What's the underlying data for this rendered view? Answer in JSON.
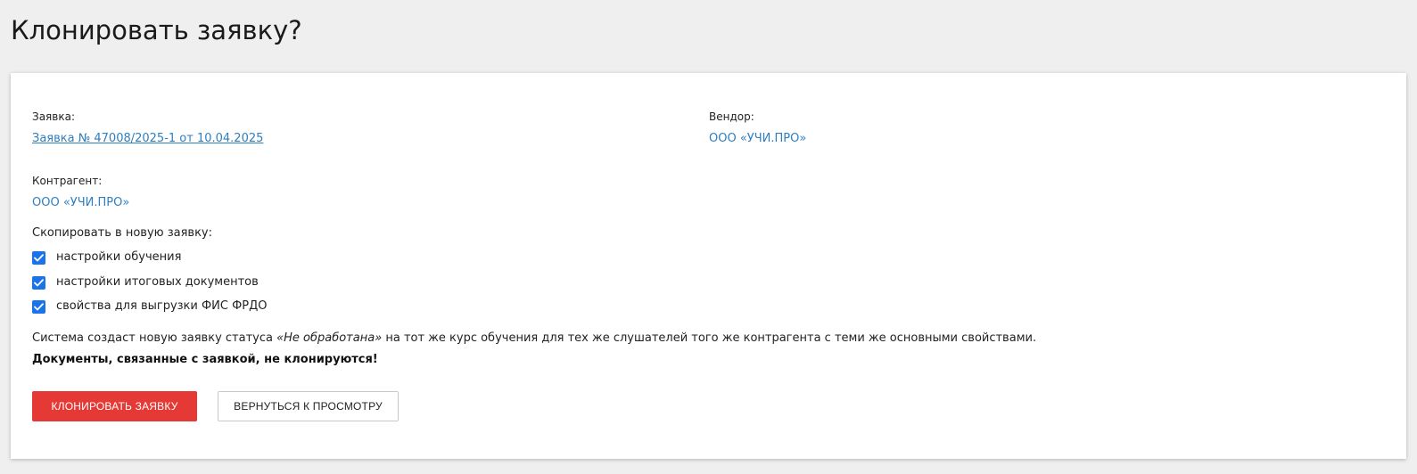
{
  "page": {
    "title": "Клонировать заявку?"
  },
  "request": {
    "label": "Заявка:",
    "value": "Заявка № 47008/2025-1 от 10.04.2025"
  },
  "vendor": {
    "label": "Вендор:",
    "value": "ООО «УЧИ.ПРО»"
  },
  "counterparty": {
    "label": "Контрагент:",
    "value": "ООО «УЧИ.ПРО»"
  },
  "copy": {
    "title": "Скопировать в новую заявку:",
    "options": [
      {
        "label": "настройки обучения",
        "checked": true
      },
      {
        "label": "настройки итоговых документов",
        "checked": true
      },
      {
        "label": "свойства для выгрузки ФИС ФРДО",
        "checked": true
      }
    ]
  },
  "info": {
    "prefix": "Система создаст новую заявку статуса ",
    "status": "«Не обработана»",
    "suffix": " на тот же курс обучения для тех же слушателей того же контрагента с теми же основными свойствами.",
    "warning": "Документы, связанные с заявкой, не клонируются!"
  },
  "actions": {
    "clone_label": "КЛОНИРОВАТЬ ЗАЯВКУ",
    "back_label": "ВЕРНУТЬСЯ К ПРОСМОТРУ"
  },
  "colors": {
    "link": "#2e7fc1",
    "checkbox": "#1a73e8",
    "primary_button": "#e53935",
    "background": "#efefef"
  }
}
